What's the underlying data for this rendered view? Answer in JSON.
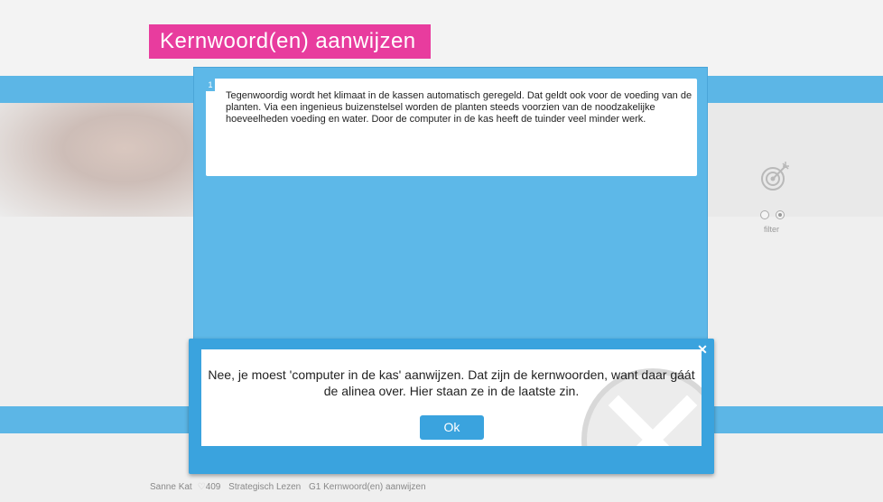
{
  "title": "Kernwoord(en) aanwijzen",
  "passage": {
    "number": "1",
    "text": "Tegenwoordig wordt het klimaat in de kassen automatisch geregeld. Dat geldt ook voor de voeding van de planten. Via een ingenieus buizenstelsel worden de planten steeds voorzien van de noodzakelijke hoeveelheden voeding en water. Door de computer in de kas heeft de tuinder veel minder werk."
  },
  "filter": {
    "label": "filter",
    "icon": "target-arrow-icon"
  },
  "dialog": {
    "message": "Nee, je moest 'computer in de kas' aanwijzen. Dat zijn de kernwoorden, want daar gáát de alinea over. Hier staan ze in de laatste zin.",
    "ok_label": "Ok",
    "close_label": "✕"
  },
  "footer": {
    "user": "Sanne Kat",
    "score": "409",
    "course": "Strategisch Lezen",
    "lesson": "G1 Kernwoord(en) aanwijzen"
  },
  "colors": {
    "accent_pink": "#e83c9e",
    "panel_blue": "#5db8e8",
    "dialog_blue": "#3aa3de"
  }
}
